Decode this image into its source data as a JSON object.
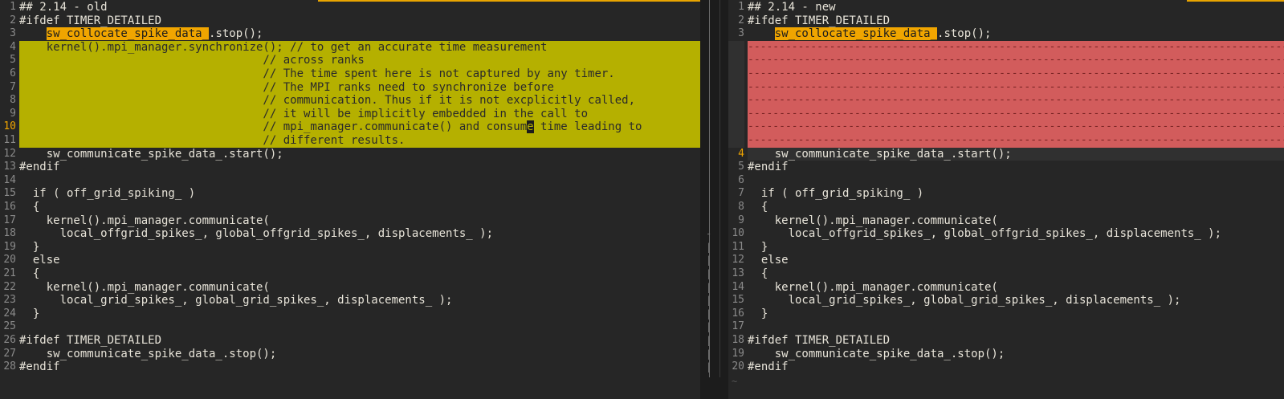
{
  "left_pane": {
    "lines": [
      {
        "num": "1",
        "text": "## 2.14 - old"
      },
      {
        "num": "2",
        "text": "#ifdef TIMER_DETAILED"
      },
      {
        "num": "3",
        "pre": "    ",
        "hl": "sw_collocate_spike_data_",
        "post": ".stop();"
      },
      {
        "num": "4",
        "text": "    kernel().mpi_manager.synchronize(); // to get an accurate time measurement",
        "changed": true
      },
      {
        "num": "5",
        "text": "                                    // across ranks",
        "changed": true
      },
      {
        "num": "6",
        "text": "                                    // The time spent here is not captured by any timer.",
        "changed": true
      },
      {
        "num": "7",
        "text": "                                    // The MPI ranks need to synchronize before",
        "changed": true
      },
      {
        "num": "8",
        "text": "                                    // communication. Thus if it is not excplicitly called,",
        "changed": true
      },
      {
        "num": "9",
        "text": "                                    // it will be implicitly embedded in the call to",
        "changed": true
      },
      {
        "num": "10",
        "pre": "                                    // mpi_manager.communicate() and consum",
        "cursor": "e",
        "post": " time leading to",
        "changed": true,
        "current": true
      },
      {
        "num": "11",
        "text": "                                    // different results.",
        "changed": true
      },
      {
        "num": "12",
        "text": "    sw_communicate_spike_data_.start();"
      },
      {
        "num": "13",
        "text": "#endif"
      },
      {
        "num": "14",
        "text": ""
      },
      {
        "num": "15",
        "text": "  if ( off_grid_spiking_ )"
      },
      {
        "num": "16",
        "text": "  {"
      },
      {
        "num": "17",
        "text": "    kernel().mpi_manager.communicate("
      },
      {
        "num": "18",
        "text": "      local_offgrid_spikes_, global_offgrid_spikes_, displacements_ );"
      },
      {
        "num": "19",
        "text": "  }"
      },
      {
        "num": "20",
        "text": "  else"
      },
      {
        "num": "21",
        "text": "  {"
      },
      {
        "num": "22",
        "text": "    kernel().mpi_manager.communicate("
      },
      {
        "num": "23",
        "text": "      local_grid_spikes_, global_grid_spikes_, displacements_ );"
      },
      {
        "num": "24",
        "text": "  }"
      },
      {
        "num": "25",
        "text": ""
      },
      {
        "num": "26",
        "text": "#ifdef TIMER_DETAILED"
      },
      {
        "num": "27",
        "text": "    sw_communicate_spike_data_.stop();"
      },
      {
        "num": "28",
        "text": "#endif"
      }
    ]
  },
  "right_pane": {
    "lines": [
      {
        "num": "1",
        "text": "## 2.14 - new"
      },
      {
        "num": "2",
        "text": "#ifdef TIMER_DETAILED"
      },
      {
        "num": "3",
        "pre": "    ",
        "hl": "sw_collocate_spike_data_",
        "post": ".stop();"
      },
      {
        "num": "",
        "text": "-----------------------------------------------------------------------------------------------",
        "deleted": true
      },
      {
        "num": "",
        "text": "-----------------------------------------------------------------------------------------------",
        "deleted": true
      },
      {
        "num": "",
        "text": "-----------------------------------------------------------------------------------------------",
        "deleted": true
      },
      {
        "num": "",
        "text": "-----------------------------------------------------------------------------------------------",
        "deleted": true
      },
      {
        "num": "",
        "text": "-----------------------------------------------------------------------------------------------",
        "deleted": true
      },
      {
        "num": "",
        "text": "-----------------------------------------------------------------------------------------------",
        "deleted": true
      },
      {
        "num": "",
        "text": "-----------------------------------------------------------------------------------------------",
        "deleted": true
      },
      {
        "num": "",
        "text": "-----------------------------------------------------------------------------------------------",
        "deleted": true
      },
      {
        "num": "4",
        "text": "    sw_communicate_spike_data_.start();",
        "current": true
      },
      {
        "num": "5",
        "text": "#endif"
      },
      {
        "num": "6",
        "text": ""
      },
      {
        "num": "7",
        "text": "  if ( off_grid_spiking_ )"
      },
      {
        "num": "8",
        "text": "  {"
      },
      {
        "num": "9",
        "text": "    kernel().mpi_manager.communicate("
      },
      {
        "num": "10",
        "text": "      local_offgrid_spikes_, global_offgrid_spikes_, displacements_ );"
      },
      {
        "num": "11",
        "text": "  }"
      },
      {
        "num": "12",
        "text": "  else"
      },
      {
        "num": "13",
        "text": "  {"
      },
      {
        "num": "14",
        "text": "    kernel().mpi_manager.communicate("
      },
      {
        "num": "15",
        "text": "      local_grid_spikes_, global_grid_spikes_, displacements_ );"
      },
      {
        "num": "16",
        "text": "  }"
      },
      {
        "num": "17",
        "text": ""
      },
      {
        "num": "18",
        "text": "#ifdef TIMER_DETAILED"
      },
      {
        "num": "19",
        "text": "    sw_communicate_spike_data_.stop();"
      },
      {
        "num": "20",
        "text": "#endif"
      }
    ]
  },
  "separator": {
    "glyph_dash": "-",
    "glyph_bar": "|",
    "tilde": "~"
  },
  "colors": {
    "changed": "#b5b000",
    "deleted": "#d25c5c",
    "search_highlight": "#f0a500",
    "current_line_number": "#f0a500"
  }
}
